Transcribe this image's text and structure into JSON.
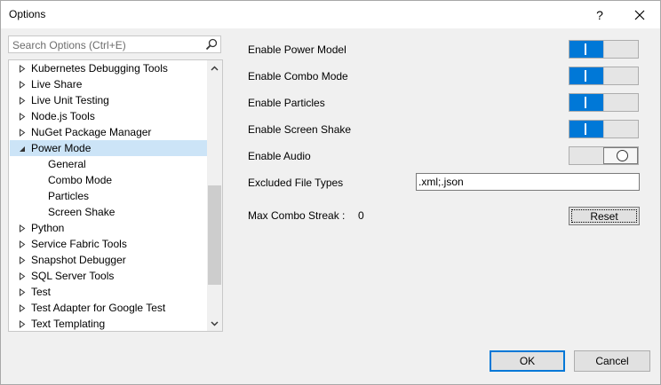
{
  "window": {
    "title": "Options",
    "help_glyph": "?",
    "close_glyph": "✕"
  },
  "search": {
    "placeholder": "Search Options (Ctrl+E)"
  },
  "tree": {
    "items": [
      {
        "label": "Kubernetes Debugging Tools",
        "expanded": false,
        "child": false
      },
      {
        "label": "Live Share",
        "expanded": false,
        "child": false
      },
      {
        "label": "Live Unit Testing",
        "expanded": false,
        "child": false
      },
      {
        "label": "Node.js Tools",
        "expanded": false,
        "child": false
      },
      {
        "label": "NuGet Package Manager",
        "expanded": false,
        "child": false
      },
      {
        "label": "Power Mode",
        "expanded": true,
        "child": false,
        "selected": true
      },
      {
        "label": "General",
        "child": true
      },
      {
        "label": "Combo Mode",
        "child": true
      },
      {
        "label": "Particles",
        "child": true
      },
      {
        "label": "Screen Shake",
        "child": true
      },
      {
        "label": "Python",
        "expanded": false,
        "child": false
      },
      {
        "label": "Service Fabric Tools",
        "expanded": false,
        "child": false
      },
      {
        "label": "Snapshot Debugger",
        "expanded": false,
        "child": false
      },
      {
        "label": "SQL Server Tools",
        "expanded": false,
        "child": false
      },
      {
        "label": "Test",
        "expanded": false,
        "child": false
      },
      {
        "label": "Test Adapter for Google Test",
        "expanded": false,
        "child": false
      },
      {
        "label": "Text Templating",
        "expanded": false,
        "child": false
      }
    ]
  },
  "settings": {
    "enable_power_model": {
      "label": "Enable Power Model",
      "on": true
    },
    "enable_combo_mode": {
      "label": "Enable Combo Mode",
      "on": true
    },
    "enable_particles": {
      "label": "Enable Particles",
      "on": true
    },
    "enable_screen_shake": {
      "label": "Enable Screen Shake",
      "on": true
    },
    "enable_audio": {
      "label": "Enable Audio",
      "on": false
    },
    "excluded_file_types": {
      "label": "Excluded File Types",
      "value": ".xml;.json"
    },
    "max_combo_streak": {
      "label": "Max Combo Streak :",
      "value": "0"
    }
  },
  "buttons": {
    "reset": "Reset",
    "ok": "OK",
    "cancel": "Cancel"
  },
  "colors": {
    "accent": "#0078d7",
    "selection": "#cce4f7"
  }
}
